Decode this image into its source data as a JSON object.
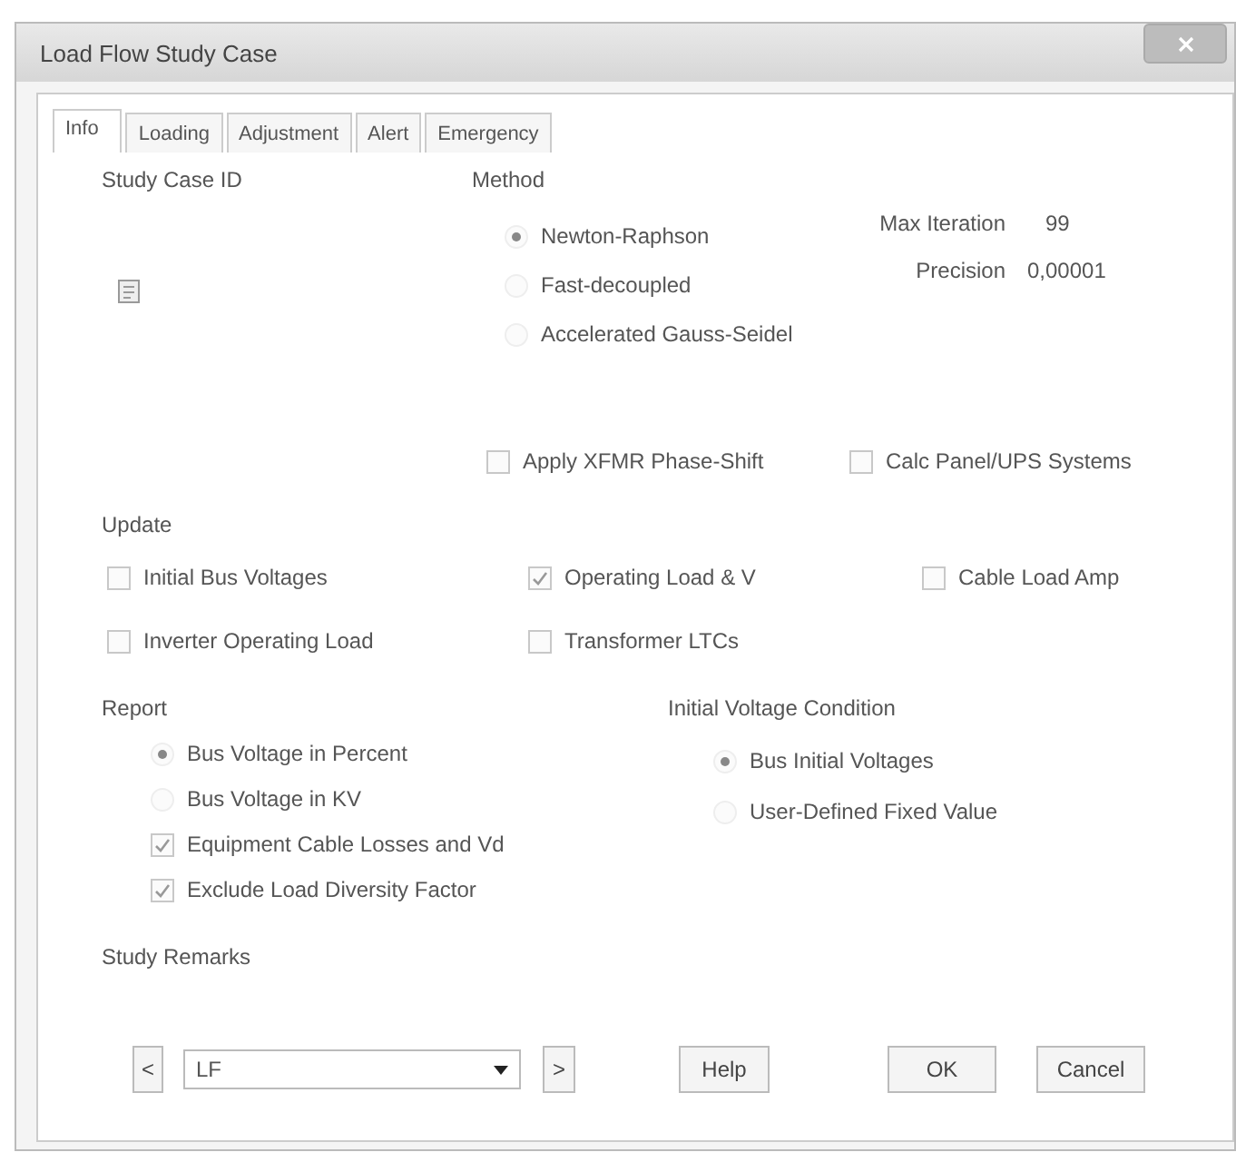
{
  "window": {
    "title": "Load Flow Study Case"
  },
  "tabs": [
    {
      "label": "Info",
      "selected": true
    },
    {
      "label": "Loading",
      "selected": false
    },
    {
      "label": "Adjustment",
      "selected": false
    },
    {
      "label": "Alert",
      "selected": false
    },
    {
      "label": "Emergency",
      "selected": false
    }
  ],
  "study_case_id": {
    "label": "Study Case ID"
  },
  "method": {
    "label": "Method",
    "options": [
      {
        "label": "Newton-Raphson",
        "selected": true
      },
      {
        "label": "Fast-decoupled",
        "selected": false
      },
      {
        "label": "Accelerated Gauss-Seidel",
        "selected": false
      }
    ],
    "max_iteration": {
      "label": "Max  Iteration",
      "value": "99"
    },
    "precision": {
      "label": "Precision",
      "value": "0,00001"
    }
  },
  "method_options": [
    {
      "label": "Apply XFMR Phase-Shift",
      "checked": false
    },
    {
      "label": "Calc  Panel/UPS Systems",
      "checked": false
    }
  ],
  "update": {
    "label": "Update",
    "checkboxes": [
      {
        "label": "Initial Bus Voltages",
        "checked": false
      },
      {
        "label": "Operating Load & V",
        "checked": true
      },
      {
        "label": "Cable Load Amp",
        "checked": false
      },
      {
        "label": "Inverter Operating Load",
        "checked": false
      },
      {
        "label": "Transformer LTCs",
        "checked": false
      }
    ]
  },
  "report": {
    "label": "Report",
    "options": [
      {
        "kind": "radio",
        "label": "Bus Voltage in Percent",
        "selected": true
      },
      {
        "kind": "radio",
        "label": "Bus Voltage in KV",
        "selected": false
      },
      {
        "kind": "checkbox",
        "label": "Equipment Cable Losses and Vd",
        "checked": true
      },
      {
        "kind": "checkbox",
        "label": "Exclude Load Diversity Factor",
        "checked": true
      }
    ]
  },
  "initial_voltage_condition": {
    "label": "Initial Voltage Condition",
    "options": [
      {
        "label": "Bus Initial Voltages",
        "selected": true
      },
      {
        "label": "User-Defined Fixed Value",
        "selected": false
      }
    ]
  },
  "study_remarks": {
    "label": "Study Remarks"
  },
  "footer": {
    "prev": "<",
    "combo": {
      "value": "LF"
    },
    "next": ">",
    "buttons": [
      "Help",
      "OK",
      "Cancel"
    ]
  }
}
